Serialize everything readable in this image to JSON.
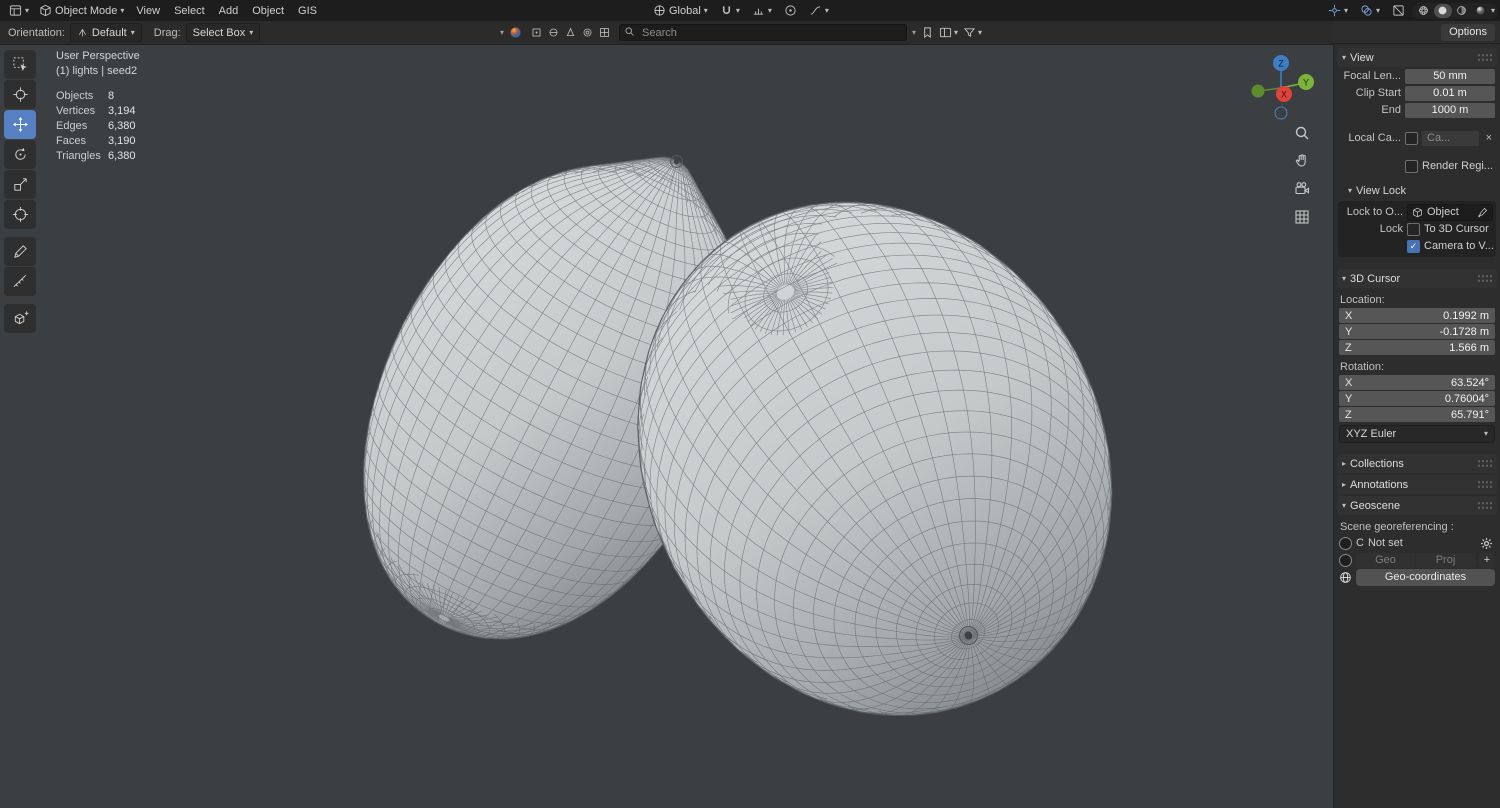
{
  "topbar": {
    "mode_label": "Object Mode",
    "menus": [
      {
        "label": "View"
      },
      {
        "label": "Select"
      },
      {
        "label": "Add"
      },
      {
        "label": "Object"
      },
      {
        "label": "GIS"
      }
    ],
    "orientation": "Global",
    "options_label": "Options"
  },
  "toolheader": {
    "orientation_label": "Orientation:",
    "orientation_value": "Default",
    "drag_label": "Drag:",
    "drag_value": "Select Box",
    "search_placeholder": "Search"
  },
  "overlay": {
    "view_name": "User Perspective",
    "context": "(1) lights | seed2",
    "stats": [
      {
        "label": "Objects",
        "value": "8"
      },
      {
        "label": "Vertices",
        "value": "3,194"
      },
      {
        "label": "Edges",
        "value": "6,380"
      },
      {
        "label": "Faces",
        "value": "3,190"
      },
      {
        "label": "Triangles",
        "value": "6,380"
      }
    ]
  },
  "sidebar": {
    "view": {
      "title": "View",
      "rows": [
        {
          "label": "Focal Len...",
          "value": "50 mm"
        },
        {
          "label": "Clip Start",
          "value": "0.01 m"
        },
        {
          "label": "End",
          "value": "1000 m"
        }
      ],
      "local_camera_label": "Local Ca...",
      "local_camera_value": "Ca...",
      "render_region_label": "Render Regi..."
    },
    "view_lock": {
      "title": "View Lock",
      "lock_to_label": "Lock to O...",
      "lock_to_value": "Object",
      "lock_label": "Lock",
      "to_3d_cursor_label": "To 3D Cursor",
      "camera_to_view_label": "Camera to V..."
    },
    "cursor": {
      "title": "3D Cursor",
      "location_label": "Location:",
      "location": [
        {
          "axis": "X",
          "value": "0.1992 m"
        },
        {
          "axis": "Y",
          "value": "-0.1728 m"
        },
        {
          "axis": "Z",
          "value": "1.566 m"
        }
      ],
      "rotation_label": "Rotation:",
      "rotation": [
        {
          "axis": "X",
          "value": "63.524°"
        },
        {
          "axis": "Y",
          "value": "0.76004°"
        },
        {
          "axis": "Z",
          "value": "65.791°"
        }
      ],
      "euler_mode": "XYZ Euler"
    },
    "collections_title": "Collections",
    "annotations_title": "Annotations",
    "geoscene": {
      "title": "Geoscene",
      "subtitle": "Scene georeferencing :",
      "crs_letter": "C",
      "crs_value": "Not set",
      "geo_label": "Geo",
      "proj_label": "Proj",
      "plus_label": "+",
      "geo_coordinates_label": "Geo-coordinates"
    }
  },
  "gizmo": {
    "x_label": "X",
    "y_label": "Y",
    "z_label": "Z"
  },
  "colors": {
    "axis_x": "#e0433c",
    "axis_y": "#7cb43b",
    "axis_z": "#3f7dc4",
    "accent_blue": "#4772b3",
    "viewport_bg": "#3c3f42"
  },
  "icons": {
    "search": "magnifier",
    "snap": "magnet",
    "zoom": "magnifier",
    "pan": "hand",
    "camera_view": "camera",
    "ortho_toggle": "grid",
    "geoscene": "globe",
    "settings": "gear",
    "pick": "eyedropper"
  }
}
